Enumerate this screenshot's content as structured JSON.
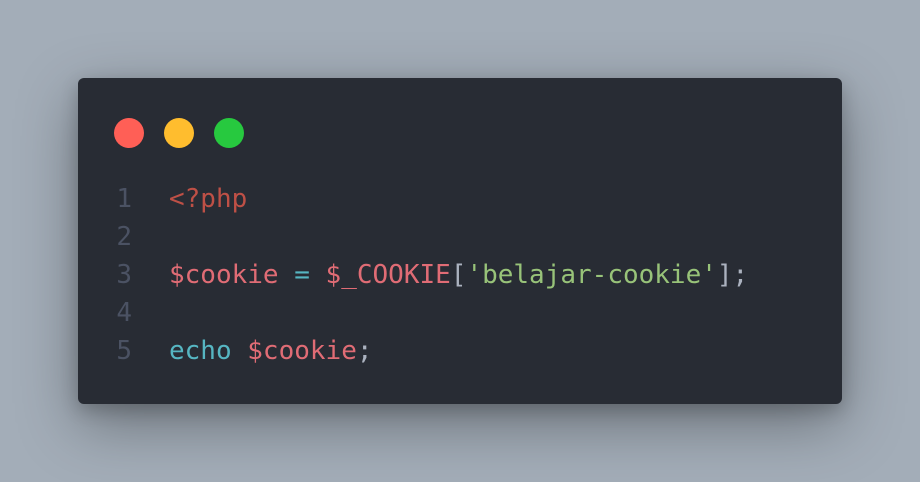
{
  "window": {
    "controls": [
      {
        "name": "close",
        "color": "#ff5f56"
      },
      {
        "name": "minimize",
        "color": "#ffbd2e"
      },
      {
        "name": "maximize",
        "color": "#27c93f"
      }
    ]
  },
  "editor": {
    "lines": [
      {
        "number": "1",
        "tokens": [
          {
            "text": "<?php",
            "kind": "tag"
          }
        ]
      },
      {
        "number": "2",
        "tokens": []
      },
      {
        "number": "3",
        "tokens": [
          {
            "text": "$cookie",
            "kind": "var"
          },
          {
            "text": " ",
            "kind": "punct"
          },
          {
            "text": "=",
            "kind": "op"
          },
          {
            "text": " ",
            "kind": "punct"
          },
          {
            "text": "$_COOKIE",
            "kind": "var"
          },
          {
            "text": "[",
            "kind": "punct"
          },
          {
            "text": "'belajar-cookie'",
            "kind": "str"
          },
          {
            "text": "];",
            "kind": "punct"
          }
        ]
      },
      {
        "number": "4",
        "tokens": []
      },
      {
        "number": "5",
        "tokens": [
          {
            "text": "echo",
            "kind": "kw"
          },
          {
            "text": " ",
            "kind": "punct"
          },
          {
            "text": "$cookie",
            "kind": "var"
          },
          {
            "text": ";",
            "kind": "punct"
          }
        ]
      }
    ]
  }
}
